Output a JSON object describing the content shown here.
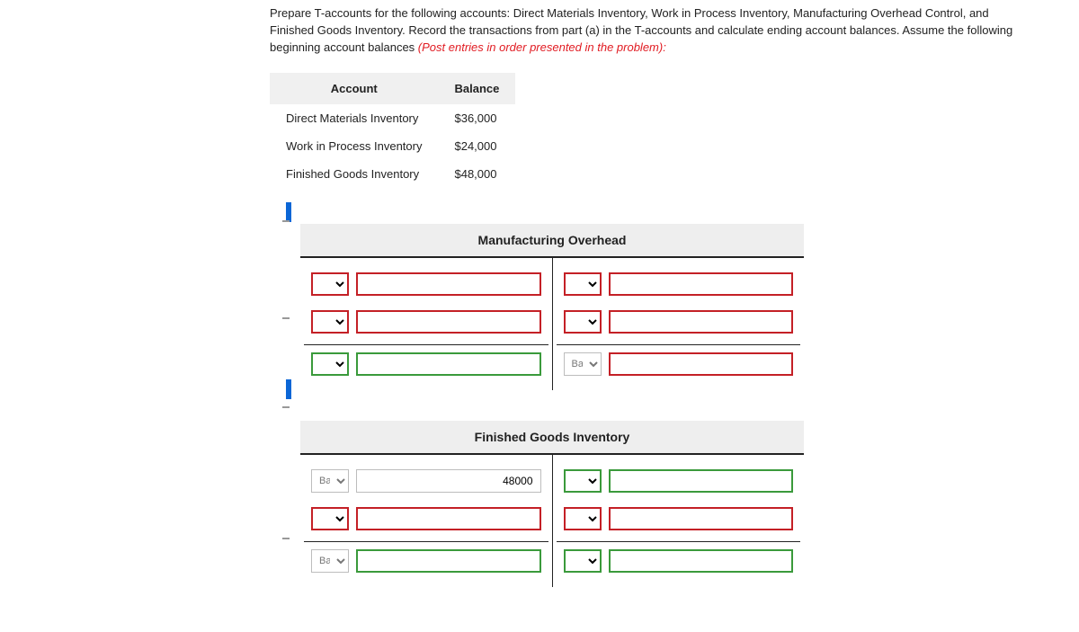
{
  "instructions": {
    "line1": "Prepare T-accounts for the following accounts: Direct Materials Inventory, Work in Process Inventory, Manufacturing Overhead Control, and Finished Goods Inventory. Record the transactions from part (a) in the T-accounts and calculate ending account balances. Assume the following beginning account balances ",
    "red": "(Post entries in order presented in the problem):"
  },
  "balances_table": {
    "headers": {
      "account": "Account",
      "balance": "Balance"
    },
    "rows": [
      {
        "account": "Direct Materials Inventory",
        "balance": "$36,000"
      },
      {
        "account": "Work in Process Inventory",
        "balance": "$24,000"
      },
      {
        "account": "Finished Goods Inventory",
        "balance": "$48,000"
      }
    ]
  },
  "t_accounts": [
    {
      "title": "Manufacturing Overhead",
      "left": {
        "rows": [
          {
            "dd_style": "red",
            "dd_value": "",
            "inp_style": "red",
            "inp_value": ""
          },
          {
            "dd_style": "red",
            "dd_value": "",
            "inp_style": "red",
            "inp_value": ""
          }
        ],
        "footer": [
          {
            "dd_style": "green",
            "dd_value": "",
            "inp_style": "green",
            "inp_value": ""
          }
        ]
      },
      "right": {
        "rows": [
          {
            "dd_style": "red",
            "dd_value": "",
            "inp_style": "red",
            "inp_value": ""
          },
          {
            "dd_style": "red",
            "dd_value": "",
            "inp_style": "red",
            "inp_value": ""
          }
        ],
        "footer": [
          {
            "dd_style": "gray",
            "dd_value": "Bal.",
            "inp_style": "red",
            "inp_value": ""
          }
        ]
      }
    },
    {
      "title": "Finished Goods Inventory",
      "left": {
        "rows": [
          {
            "dd_style": "gray",
            "dd_value": "Bal.",
            "inp_style": "gray",
            "inp_value": "48000"
          },
          {
            "dd_style": "red",
            "dd_value": "",
            "inp_style": "red",
            "inp_value": ""
          }
        ],
        "footer": [
          {
            "dd_style": "gray",
            "dd_value": "Bal.",
            "inp_style": "green",
            "inp_value": ""
          }
        ]
      },
      "right": {
        "rows": [
          {
            "dd_style": "green",
            "dd_value": "",
            "inp_style": "green",
            "inp_value": ""
          },
          {
            "dd_style": "red",
            "dd_value": "",
            "inp_style": "red",
            "inp_value": ""
          }
        ],
        "footer": [
          {
            "dd_style": "green",
            "dd_value": "",
            "inp_style": "green",
            "inp_value": ""
          }
        ]
      }
    }
  ]
}
